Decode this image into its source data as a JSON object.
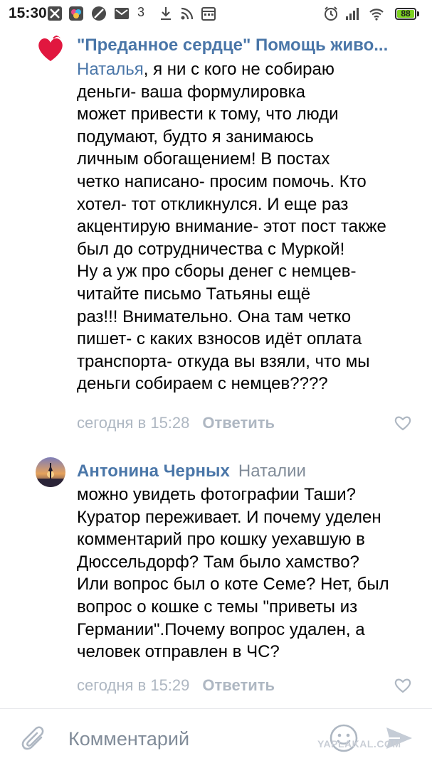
{
  "status_bar": {
    "time": "15:30",
    "notification_badge": "3",
    "battery_level": "88",
    "icons": [
      "blocked-icon",
      "vk-icon",
      "blocked-icon",
      "mail-icon",
      "download-icon",
      "rss-icon",
      "calendar-icon",
      "alarm-icon",
      "signal-icon",
      "wifi-icon",
      "battery-icon"
    ]
  },
  "comments": [
    {
      "author": "\"Преданное сердце\" Помощь живо...",
      "reply_to": "",
      "mention": "Наталья",
      "lines": [
        ", я ни с кого не собираю",
        "деньги- ваша формулировка",
        "может привести к тому, что люди",
        "подумают, будто я занимаюсь",
        "личным обогащением! В постах",
        "четко написано- просим помочь. Кто",
        "хотел- тот откликнулся. И еще раз",
        "акцентирую внимание- этот пост также",
        "был до сотрудничества с Муркой!",
        "Ну а уж про сборы денег с немцев-",
        "читайте письмо Татьяны ещё",
        "раз!!! Внимательно. Она там четко",
        "пишет- с каких взносов идёт оплата",
        "транспорта- откуда вы взяли, что мы",
        "деньги собираем с немцев????"
      ],
      "date": "сегодня в 15:28",
      "reply_label": "Ответить"
    },
    {
      "author": "Антонина Черных",
      "reply_to": "Наталии",
      "mention": "",
      "lines": [
        "можно увидеть фотографии Таши?",
        "Куратор переживает. И почему уделен",
        "комментарий про кошку уехавшую в",
        "Дюссельдорф? Там было хамство?",
        "Или вопрос был о коте Семе? Нет, был",
        "вопрос о кошке с темы \"приветы из",
        "Германии\".Почему вопрос удален, а",
        "человек отправлен в ЧС?"
      ],
      "date": "сегодня в 15:29",
      "reply_label": "Ответить"
    }
  ],
  "composer": {
    "placeholder": "Комментарий",
    "watermark": "YAPLAKAL.COM"
  },
  "colors": {
    "link": "#4a76a8",
    "secondary": "#818c99",
    "meta": "#aeb7c2",
    "heart": "#e1173f",
    "battery": "#7ed321"
  }
}
